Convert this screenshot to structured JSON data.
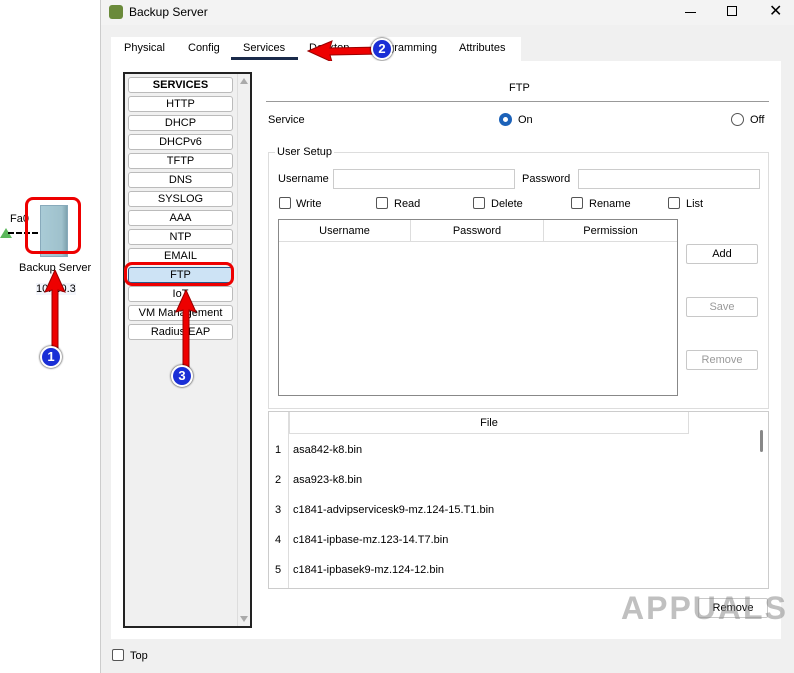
{
  "canvas": {
    "device_label": "Backup Server",
    "ip_label": "10.0.0.3",
    "port_label": "Fa0"
  },
  "window": {
    "title": "Backup Server"
  },
  "tabs": [
    "Physical",
    "Config",
    "Services",
    "Desktop",
    "Programming",
    "Attributes"
  ],
  "services": {
    "header": "SERVICES",
    "items": [
      "HTTP",
      "DHCP",
      "DHCPv6",
      "TFTP",
      "DNS",
      "SYSLOG",
      "AAA",
      "NTP",
      "EMAIL",
      "FTP",
      "IoT",
      "VM Management",
      "Radius EAP"
    ],
    "selected": "FTP"
  },
  "ftp": {
    "title": "FTP",
    "service_label": "Service",
    "on_label": "On",
    "off_label": "Off",
    "service_state": "On",
    "user_setup": "User Setup",
    "username_label": "Username",
    "username_value": "",
    "password_label": "Password",
    "password_value": "",
    "perms": [
      "Write",
      "Read",
      "Delete",
      "Rename",
      "List"
    ],
    "table_headers": [
      "Username",
      "Password",
      "Permission"
    ],
    "add": "Add",
    "save": "Save",
    "remove": "Remove",
    "file_header": "File",
    "files": [
      {
        "n": "1",
        "name": "asa842-k8.bin"
      },
      {
        "n": "2",
        "name": "asa923-k8.bin"
      },
      {
        "n": "3",
        "name": "c1841-advipservicesk9-mz.124-15.T1.bin"
      },
      {
        "n": "4",
        "name": "c1841-ipbase-mz.123-14.T7.bin"
      },
      {
        "n": "5",
        "name": "c1841-ipbasek9-mz.124-12.bin"
      }
    ],
    "file_remove": "Remove"
  },
  "footer": {
    "top_label": "Top"
  },
  "annotations": [
    "1",
    "2",
    "3"
  ],
  "watermark": "APPUALS"
}
